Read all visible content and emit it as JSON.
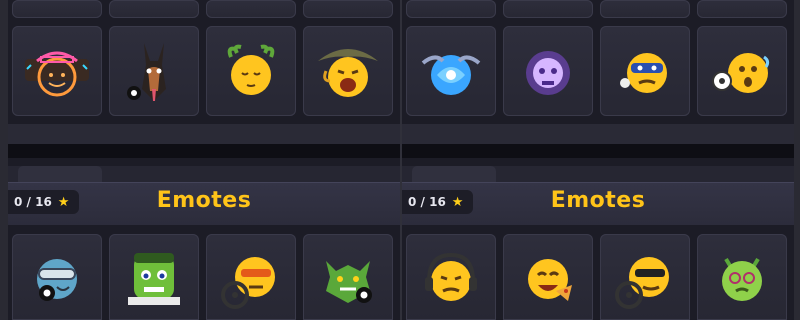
{
  "panels": [
    {
      "counter": "0 / 16",
      "star_icon": "star-icon",
      "title": "Emotes",
      "top_icons": [
        "cowboy-neon-face-icon",
        "doberman-8-ball-icon",
        "laurel-relieved-face-icon",
        "cowboy-hat-yelling-face-icon"
      ],
      "bottom_icons": [
        "goggles-8-ball-face-icon",
        "frankenstein-face-icon",
        "sunglasses-steering-wheel-face-icon",
        "green-dragon-8-ball-icon"
      ]
    },
    {
      "counter": "0 / 16",
      "star_icon": "star-icon",
      "title": "Emotes",
      "top_icons": [
        "blue-swirl-orb-icon",
        "purple-ghost-skull-icon",
        "angry-masked-face-icon",
        "soccer-ball-surprised-face-icon"
      ],
      "bottom_icons": [
        "headphones-angry-face-icon",
        "pizza-laughing-face-icon",
        "sunglasses-wheel-face-icon",
        "dizzy-green-face-icon"
      ]
    }
  ],
  "colors": {
    "title": "#ffc419",
    "star": "#ffcf1a",
    "background": "#1c1c26",
    "cell": "#2e2e3c"
  }
}
